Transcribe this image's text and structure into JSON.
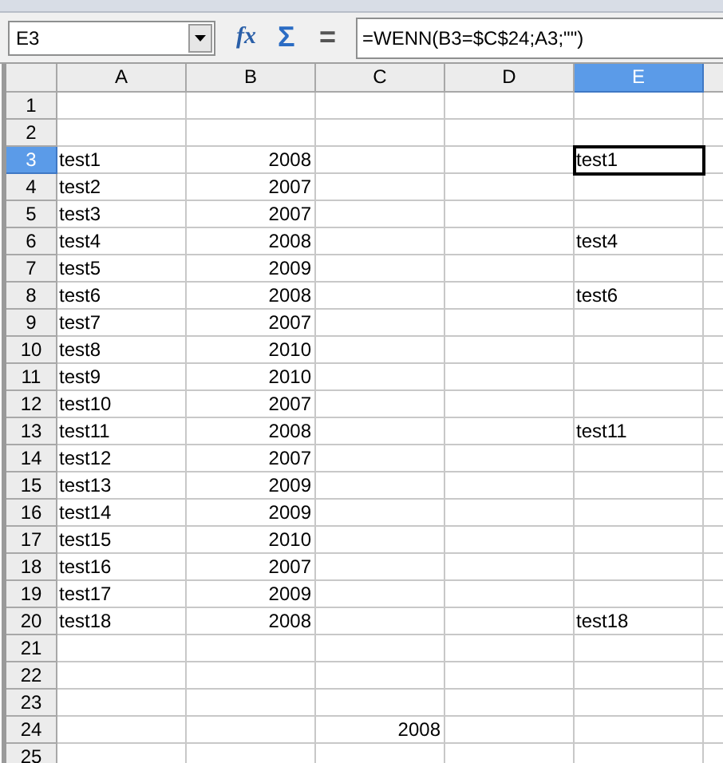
{
  "formula_bar": {
    "name_box": "E3",
    "function_wizard": "fx",
    "sum": "Σ",
    "equals": "=",
    "formula": "=WENN(B3=$C$24;A3;\"\")"
  },
  "columns": [
    {
      "label": "A",
      "selected": false
    },
    {
      "label": "B",
      "selected": false
    },
    {
      "label": "C",
      "selected": false
    },
    {
      "label": "D",
      "selected": false
    },
    {
      "label": "E",
      "selected": true
    }
  ],
  "rows": [
    {
      "header": "1",
      "selected": false,
      "cells": {}
    },
    {
      "header": "2",
      "selected": false,
      "cells": {}
    },
    {
      "header": "3",
      "selected": true,
      "cells": {
        "A": {
          "kind": "text",
          "text": "test1",
          "active": false
        },
        "B": {
          "kind": "number",
          "text": "2008",
          "active": false
        },
        "E": {
          "kind": "text",
          "text": "test1",
          "active": true
        }
      }
    },
    {
      "header": "4",
      "selected": false,
      "cells": {
        "A": {
          "kind": "text",
          "text": "test2",
          "active": false
        },
        "B": {
          "kind": "number",
          "text": "2007",
          "active": false
        }
      }
    },
    {
      "header": "5",
      "selected": false,
      "cells": {
        "A": {
          "kind": "text",
          "text": "test3",
          "active": false
        },
        "B": {
          "kind": "number",
          "text": "2007",
          "active": false
        }
      }
    },
    {
      "header": "6",
      "selected": false,
      "cells": {
        "A": {
          "kind": "text",
          "text": "test4",
          "active": false
        },
        "B": {
          "kind": "number",
          "text": "2008",
          "active": false
        },
        "E": {
          "kind": "text",
          "text": "test4",
          "active": false
        }
      }
    },
    {
      "header": "7",
      "selected": false,
      "cells": {
        "A": {
          "kind": "text",
          "text": "test5",
          "active": false
        },
        "B": {
          "kind": "number",
          "text": "2009",
          "active": false
        }
      }
    },
    {
      "header": "8",
      "selected": false,
      "cells": {
        "A": {
          "kind": "text",
          "text": "test6",
          "active": false
        },
        "B": {
          "kind": "number",
          "text": "2008",
          "active": false
        },
        "E": {
          "kind": "text",
          "text": "test6",
          "active": false
        }
      }
    },
    {
      "header": "9",
      "selected": false,
      "cells": {
        "A": {
          "kind": "text",
          "text": "test7",
          "active": false
        },
        "B": {
          "kind": "number",
          "text": "2007",
          "active": false
        }
      }
    },
    {
      "header": "10",
      "selected": false,
      "cells": {
        "A": {
          "kind": "text",
          "text": "test8",
          "active": false
        },
        "B": {
          "kind": "number",
          "text": "2010",
          "active": false
        }
      }
    },
    {
      "header": "11",
      "selected": false,
      "cells": {
        "A": {
          "kind": "text",
          "text": "test9",
          "active": false
        },
        "B": {
          "kind": "number",
          "text": "2010",
          "active": false
        }
      }
    },
    {
      "header": "12",
      "selected": false,
      "cells": {
        "A": {
          "kind": "text",
          "text": "test10",
          "active": false
        },
        "B": {
          "kind": "number",
          "text": "2007",
          "active": false
        }
      }
    },
    {
      "header": "13",
      "selected": false,
      "cells": {
        "A": {
          "kind": "text",
          "text": "test11",
          "active": false
        },
        "B": {
          "kind": "number",
          "text": "2008",
          "active": false
        },
        "E": {
          "kind": "text",
          "text": "test11",
          "active": false
        }
      }
    },
    {
      "header": "14",
      "selected": false,
      "cells": {
        "A": {
          "kind": "text",
          "text": "test12",
          "active": false
        },
        "B": {
          "kind": "number",
          "text": "2007",
          "active": false
        }
      }
    },
    {
      "header": "15",
      "selected": false,
      "cells": {
        "A": {
          "kind": "text",
          "text": "test13",
          "active": false
        },
        "B": {
          "kind": "number",
          "text": "2009",
          "active": false
        }
      }
    },
    {
      "header": "16",
      "selected": false,
      "cells": {
        "A": {
          "kind": "text",
          "text": "test14",
          "active": false
        },
        "B": {
          "kind": "number",
          "text": "2009",
          "active": false
        }
      }
    },
    {
      "header": "17",
      "selected": false,
      "cells": {
        "A": {
          "kind": "text",
          "text": "test15",
          "active": false
        },
        "B": {
          "kind": "number",
          "text": "2010",
          "active": false
        }
      }
    },
    {
      "header": "18",
      "selected": false,
      "cells": {
        "A": {
          "kind": "text",
          "text": "test16",
          "active": false
        },
        "B": {
          "kind": "number",
          "text": "2007",
          "active": false
        }
      }
    },
    {
      "header": "19",
      "selected": false,
      "cells": {
        "A": {
          "kind": "text",
          "text": "test17",
          "active": false
        },
        "B": {
          "kind": "number",
          "text": "2009",
          "active": false
        }
      }
    },
    {
      "header": "20",
      "selected": false,
      "cells": {
        "A": {
          "kind": "text",
          "text": "test18",
          "active": false
        },
        "B": {
          "kind": "number",
          "text": "2008",
          "active": false
        },
        "E": {
          "kind": "text",
          "text": "test18",
          "active": false
        }
      }
    },
    {
      "header": "21",
      "selected": false,
      "cells": {}
    },
    {
      "header": "22",
      "selected": false,
      "cells": {}
    },
    {
      "header": "23",
      "selected": false,
      "cells": {}
    },
    {
      "header": "24",
      "selected": false,
      "cells": {
        "C": {
          "kind": "number",
          "text": "2008",
          "active": false
        }
      }
    },
    {
      "header": "25",
      "selected": false,
      "cells": {}
    }
  ]
}
